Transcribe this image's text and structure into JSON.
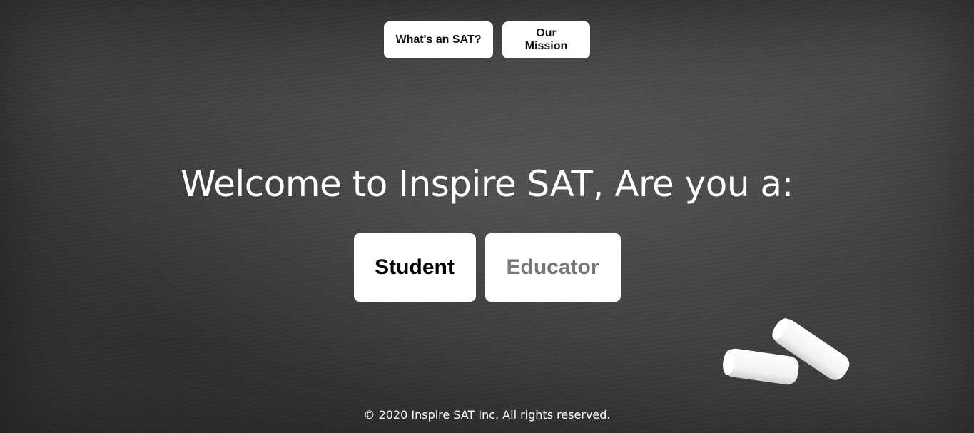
{
  "nav": {
    "whats_sat_label": "What's an SAT?",
    "mission_label": "Our Mission"
  },
  "hero": {
    "heading": "Welcome to Inspire SAT, Are you a:"
  },
  "roles": {
    "student_label": "Student",
    "educator_label": "Educator"
  },
  "footer": {
    "copyright": "© 2020 Inspire SAT Inc. All rights reserved."
  },
  "colors": {
    "background": "#3d3f41",
    "button_bg": "#ffffff",
    "text_primary": "#000000",
    "text_muted": "#777777"
  },
  "decor": {
    "chalk": "chalk-pieces-icon"
  }
}
